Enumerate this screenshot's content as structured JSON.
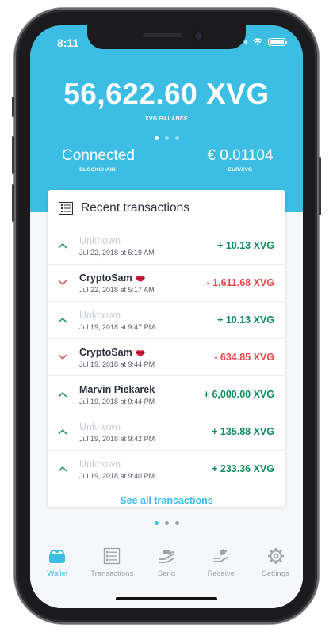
{
  "status_bar": {
    "time": "8:11"
  },
  "balance": {
    "amount": "56,622.60 XVG",
    "label": "XVG BALANCE"
  },
  "stats": {
    "left": {
      "value": "Connected",
      "label": "BLOCKCHAIN"
    },
    "right": {
      "value": "€ 0.01104",
      "label": "EUR/XVG"
    }
  },
  "card": {
    "title": "Recent transactions",
    "see_all": "See all transactions",
    "transactions": [
      {
        "name": "Unknown",
        "date": "Jul 22, 2018 at 5:19 AM",
        "amount": "+ 10.13 XVG",
        "direction": "in",
        "known": false
      },
      {
        "name": "CryptoSam",
        "date": "Jul 22, 2018 at 5:17 AM",
        "amount": "- 1,611.68 XVG",
        "direction": "out",
        "known": true,
        "emoji": "lips-icon"
      },
      {
        "name": "Unknown",
        "date": "Jul 19, 2018 at 9:47 PM",
        "amount": "+ 10.13 XVG",
        "direction": "in",
        "known": false
      },
      {
        "name": "CryptoSam",
        "date": "Jul 19, 2018 at 9:44 PM",
        "amount": "- 634.85 XVG",
        "direction": "out",
        "known": true,
        "emoji": "lips-icon"
      },
      {
        "name": "Marvin Piekarek",
        "date": "Jul 19, 2018 at 9:44 PM",
        "amount": "+ 6,000.00 XVG",
        "direction": "in",
        "known": true
      },
      {
        "name": "Unknown",
        "date": "Jul 19, 2018 at 9:42 PM",
        "amount": "+ 135.88 XVG",
        "direction": "in",
        "known": false
      },
      {
        "name": "Unknown",
        "date": "Jul 19, 2018 at 9:40 PM",
        "amount": "+ 233.36 XVG",
        "direction": "in",
        "known": false
      }
    ]
  },
  "tabs": [
    {
      "label": "Wallet",
      "icon": "wallet-icon",
      "active": true
    },
    {
      "label": "Transactions",
      "icon": "transactions-icon",
      "active": false
    },
    {
      "label": "Send",
      "icon": "send-icon",
      "active": false
    },
    {
      "label": "Receive",
      "icon": "receive-icon",
      "active": false
    },
    {
      "label": "Settings",
      "icon": "gear-icon",
      "active": false
    }
  ],
  "colors": {
    "accent": "#3bbde4",
    "positive": "#0f8c5c",
    "negative": "#e44a4a",
    "unknown_name": "#c9ced4"
  }
}
